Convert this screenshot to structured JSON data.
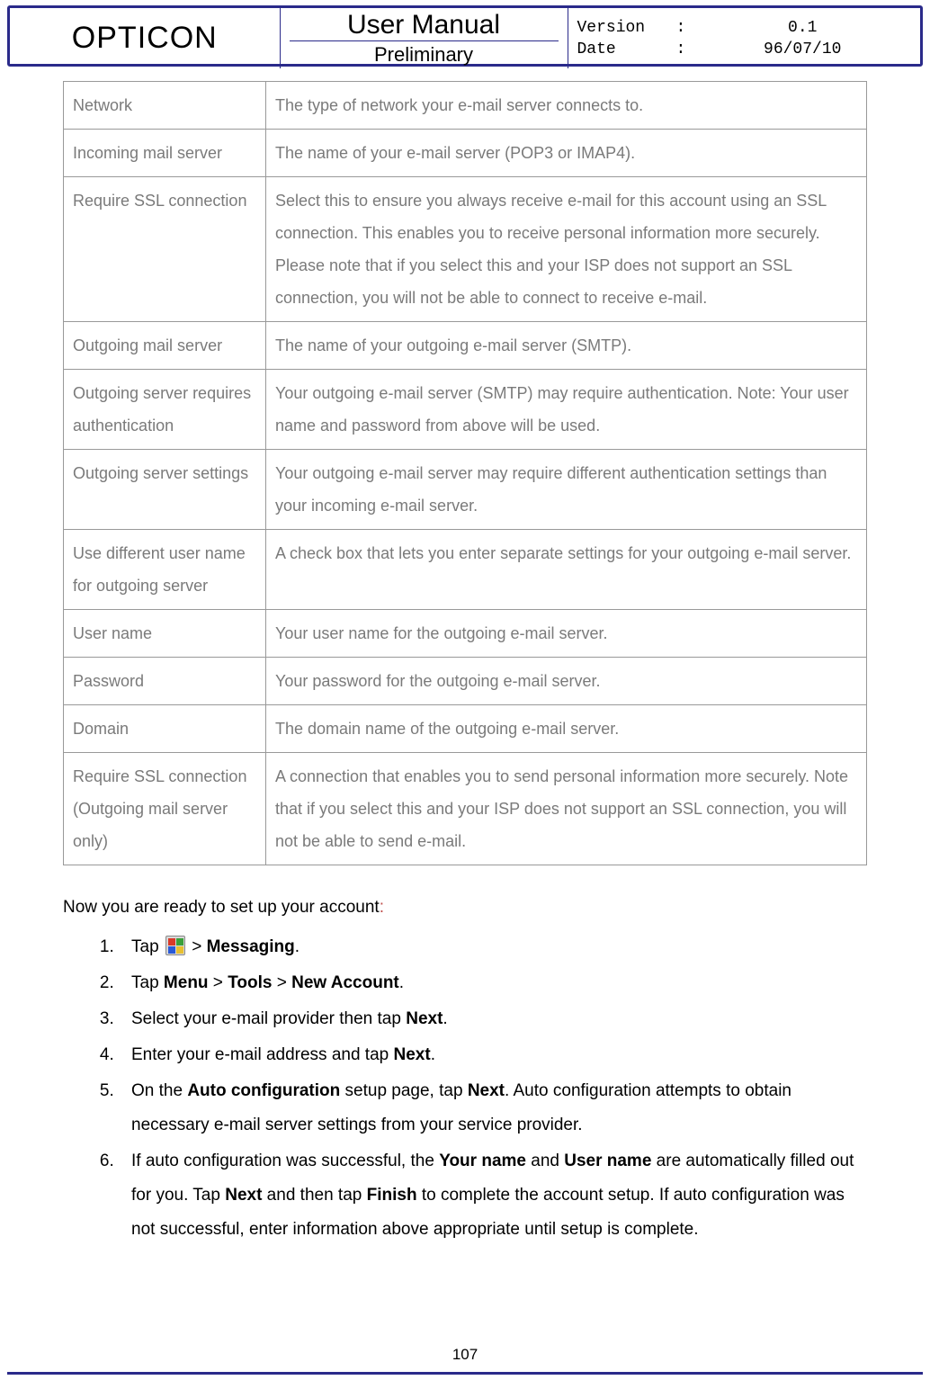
{
  "header": {
    "brand": "OPTICON",
    "title_top": "User Manual",
    "title_bot": "Preliminary",
    "meta": {
      "version_label": "Version",
      "version_value": "0.1",
      "date_label": "Date",
      "date_value": "96/07/10",
      "colon": ":"
    }
  },
  "table": {
    "rows": [
      {
        "term": "Network",
        "desc": "The type of network your e-mail server connects to."
      },
      {
        "term": "Incoming mail server",
        "desc": "The name of your e-mail server (POP3 or IMAP4)."
      },
      {
        "term": "Require SSL connection",
        "desc": "Select this to ensure you always receive e-mail for this account using an SSL connection. This enables you to receive personal information more securely. Please note that if you select this and your ISP does not support an SSL connection, you will not be able to connect to receive e-mail."
      },
      {
        "term": "Outgoing mail server",
        "desc": "The name of your outgoing e-mail server (SMTP)."
      },
      {
        "term": "Outgoing server requires authentication",
        "desc": "Your outgoing e-mail server (SMTP) may require authentication. Note: Your user name and password from above will be used."
      },
      {
        "term": "Outgoing server settings",
        "desc": "Your outgoing e-mail server may require different authentication settings than your incoming e-mail server."
      },
      {
        "term": "Use different user name for outgoing server",
        "desc": "A check box that lets you enter separate settings for your outgoing e-mail server."
      },
      {
        "term": "User name",
        "desc": "Your user name for the outgoing e-mail server."
      },
      {
        "term": "Password",
        "desc": "Your password for the outgoing e-mail server."
      },
      {
        "term": "Domain",
        "desc": "The domain name of the outgoing e-mail server."
      },
      {
        "term": "Require SSL connection (Outgoing mail server only)",
        "desc": "A connection that enables you to send personal information more securely. Note that if you select this and your ISP does not support an SSL connection, you will not be able to send e-mail."
      }
    ]
  },
  "intro": {
    "text_before": "Now you are ready to set up your account",
    "colon": ":"
  },
  "steps": {
    "s1_a": "Tap ",
    "s1_b": " > ",
    "s1_c": "Messaging",
    "s1_d": ".",
    "s2_a": "Tap ",
    "s2_menu": "Menu",
    "s2_gt1": " > ",
    "s2_tools": "Tools",
    "s2_gt2": " > ",
    "s2_new": "New Account",
    "s2_d": ".",
    "s3_a": "Select your e-mail provider then tap ",
    "s3_next": "Next",
    "s3_d": ".",
    "s4_a": "Enter your e-mail address and tap ",
    "s4_next": "Next",
    "s4_d": ".",
    "s5_a": "On the ",
    "s5_auto": "Auto configuration",
    "s5_b": " setup page, tap ",
    "s5_next": "Next",
    "s5_c": ". Auto configuration attempts to obtain necessary e-mail server settings from your service provider.",
    "s6_a": "If auto configuration was successful, the ",
    "s6_yourname": "Your name",
    "s6_b": " and ",
    "s6_username": "User name",
    "s6_c": " are automatically filled out for you. Tap ",
    "s6_next": "Next",
    "s6_d": " and then tap ",
    "s6_finish": "Finish",
    "s6_e": " to complete the account setup. If auto configuration was not successful, enter information above appropriate until setup is complete."
  },
  "page_number": "107"
}
